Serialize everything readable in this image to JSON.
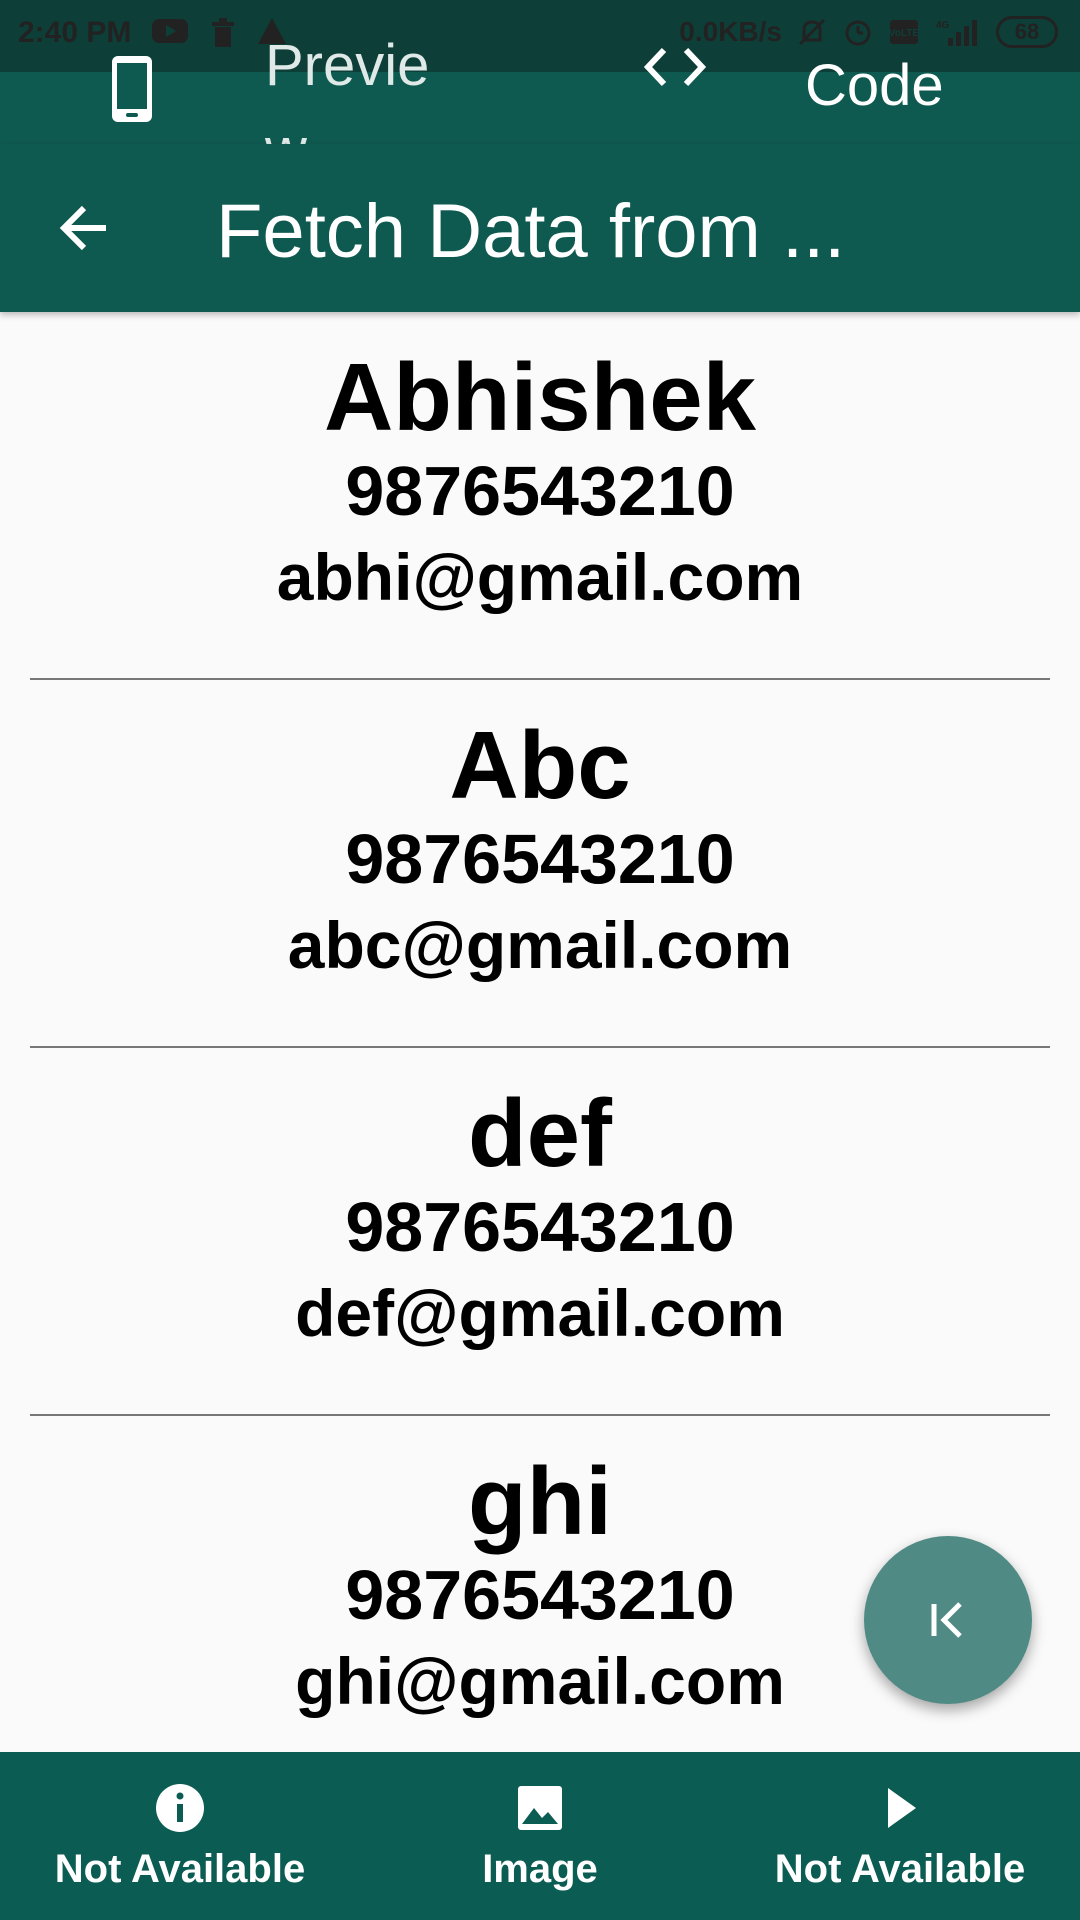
{
  "status_bar": {
    "time": "2:40 PM",
    "speed": "0.0KB/s",
    "battery": "68",
    "icons": [
      "youtube-icon",
      "trash-icon",
      "warning-icon",
      "mute-icon",
      "alarm-icon",
      "volte-icon",
      "signal-icon"
    ]
  },
  "top_tabs": {
    "preview_label": "Preview",
    "code_label": "Code"
  },
  "app_bar": {
    "title": "Fetch Data from ..."
  },
  "contacts": [
    {
      "name": "Abhishek",
      "phone": "9876543210",
      "email": "abhi@gmail.com"
    },
    {
      "name": "Abc",
      "phone": "9876543210",
      "email": "abc@gmail.com"
    },
    {
      "name": "def",
      "phone": "9876543210",
      "email": "def@gmail.com"
    },
    {
      "name": "ghi",
      "phone": "9876543210",
      "email": "ghi@gmail.com"
    }
  ],
  "bottom_nav": {
    "items": [
      {
        "label": "Not Available",
        "icon": "info-icon"
      },
      {
        "label": "Image",
        "icon": "image-icon"
      },
      {
        "label": "Not Available",
        "icon": "play-icon"
      }
    ]
  },
  "colors": {
    "primary": "#0f5a50",
    "status_bar": "#0d3f38",
    "fab": "#4f8b84",
    "background": "#fafafa"
  }
}
